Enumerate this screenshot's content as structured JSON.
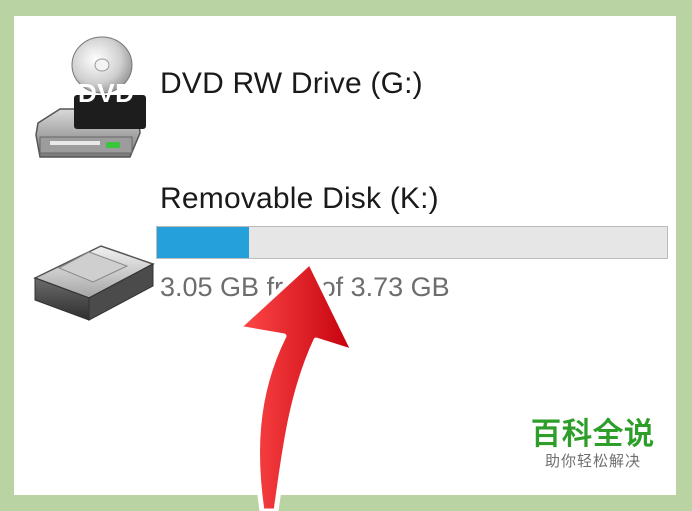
{
  "colors": {
    "frame": "#b9d3a3",
    "panel": "#ffffff",
    "usage_fill": "#26a0da",
    "usage_track": "#e6e6e6",
    "arrow": "#e3121d",
    "watermark_green": "#2e9e2b"
  },
  "drives": [
    {
      "icon": "dvd-drive-icon",
      "badge": "DVD",
      "name": "DVD RW Drive (G:)"
    },
    {
      "icon": "removable-disk-icon",
      "name": "Removable Disk (K:)",
      "usage_fraction": 0.18,
      "usage_text": "3.05 GB free of 3.73 GB"
    }
  ],
  "annotation": {
    "icon": "red-arrow-icon"
  },
  "watermark": {
    "title": "百科全说",
    "subtitle": "助你轻松解决"
  }
}
